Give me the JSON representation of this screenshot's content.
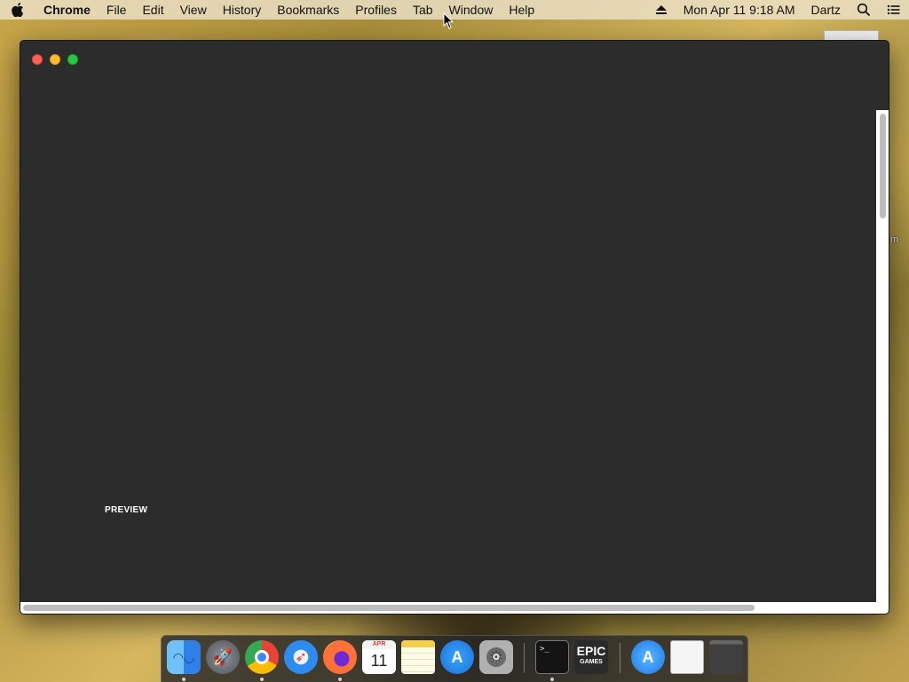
{
  "menubar": {
    "app_name": "Chrome",
    "menus": [
      "File",
      "Edit",
      "View",
      "History",
      "Bookmarks",
      "Profiles",
      "Tab",
      "Window",
      "Help"
    ],
    "datetime": "Mon Apr 11  9:18 AM",
    "user": "Dartz"
  },
  "desktop": {
    "partial_label": "m"
  },
  "window": {
    "preview_label": "PREVIEW"
  },
  "dock": {
    "calendar_month": "APR",
    "calendar_day": "11",
    "terminal_prompt": ">_",
    "epic_line1": "EPIC",
    "epic_line2": "GAMES"
  }
}
